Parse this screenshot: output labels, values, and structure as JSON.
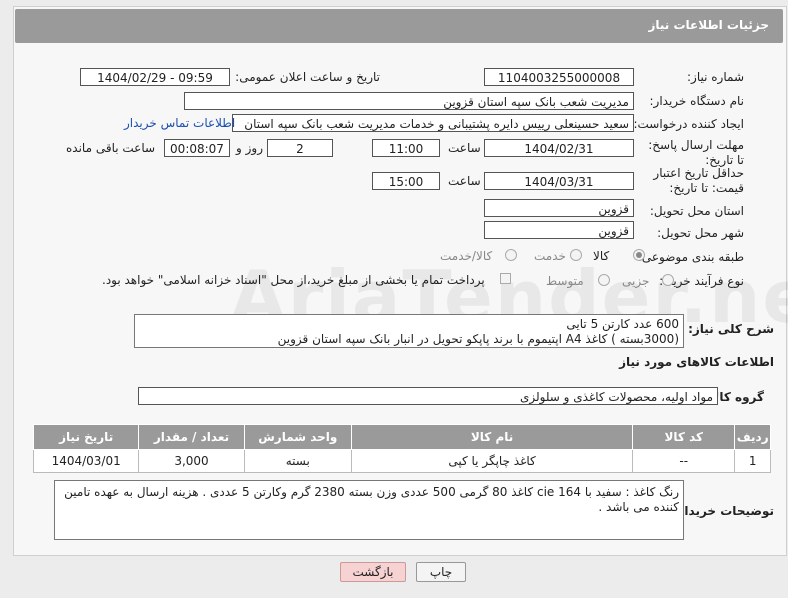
{
  "header": {
    "title": "جزئیات اطلاعات نیاز"
  },
  "watermark": "AriaTender.neT",
  "fields": {
    "need_number": {
      "label": "شماره نیاز:",
      "value": "1104003255000008"
    },
    "announce_datetime": {
      "label": "تاریخ و ساعت اعلان عمومی:",
      "value": "1404/02/29 - 09:59"
    },
    "buyer_org": {
      "label": "نام دستگاه خریدار:",
      "value": "مدیریت شعب بانک سپه استان قزوین"
    },
    "requester": {
      "label": "ایجاد کننده درخواست:",
      "value": "سعید حسینعلی رییس دایره پشتیبانی و خدمات مدیریت شعب بانک سپه استان",
      "contact_link": "اطلاعات تماس خریدار"
    },
    "reply_deadline": {
      "label": "مهلت ارسال پاسخ: تا تاریخ:",
      "date": "1404/02/31",
      "time_label": "ساعت",
      "time": "11:00",
      "days": "2",
      "days_label": "روز و",
      "remaining": "00:08:07",
      "remaining_label": "ساعت باقی مانده"
    },
    "price_validity": {
      "label": "حداقل تاریخ اعتبار قیمت: تا تاریخ:",
      "date": "1404/03/31",
      "time_label": "ساعت",
      "time": "15:00"
    },
    "delivery_province": {
      "label": "استان محل تحویل:",
      "value": "قزوین"
    },
    "delivery_city": {
      "label": "شهر محل تحویل:",
      "value": "قزوین"
    },
    "category": {
      "label": "طبقه بندی موضوعی:",
      "options": [
        "کالا",
        "خدمت",
        "کالا/خدمت"
      ],
      "selected": "کالا"
    },
    "purchase_process": {
      "label": "نوع فرآیند خرید :",
      "options": [
        "جزیی",
        "متوسط"
      ],
      "selected": "جزیی",
      "payment_note": "پرداخت تمام یا بخشی از مبلغ خرید،از محل \"اسناد خزانه اسلامی\" خواهد بود."
    }
  },
  "general_desc": {
    "label": "شرح کلی نیاز:",
    "line1": "600 عدد کارتن 5 تایی",
    "line2": "(3000بسته ) کاغذ A4 اپتیموم  با برند پاپکو تحویل در انبار بانک سپه  استان قزوین"
  },
  "goods_info": {
    "title": "اطلاعات کالاهای مورد نیاز"
  },
  "goods_group": {
    "label": "گروه کالا:",
    "value": "مواد اولیه، محصولات کاغذی و سلولزی"
  },
  "table": {
    "headers": [
      "ردیف",
      "کد کالا",
      "نام کالا",
      "واحد شمارش",
      "تعداد / مقدار",
      "تاریخ نیاز"
    ],
    "rows": [
      {
        "row": "1",
        "code": "--",
        "name": "کاغذ چاپگر یا کپی",
        "unit": "بسته",
        "qty": "3,000",
        "date": "1404/03/01"
      }
    ]
  },
  "buyer_notes": {
    "label": "توضیحات خریدار:",
    "text": "رنگ کاغذ : سفید با cie 164  کاغذ 80 گرمی 500 عددی وزن بسته 2380 گرم وکارتن 5 عددی . هزینه ارسال به عهده  تامین کننده می باشد ."
  },
  "buttons": {
    "print": "چاپ",
    "back": "بازگشت"
  }
}
